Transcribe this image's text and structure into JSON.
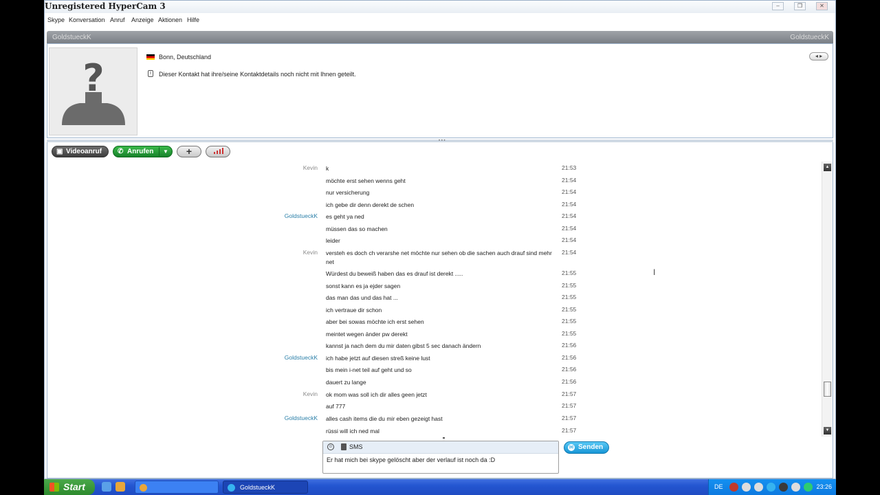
{
  "window": {
    "title": "Unregistered HyperCam 3",
    "controls": {
      "minimize": "–",
      "restore": "❐",
      "close": "✕"
    }
  },
  "menu": [
    "Skype",
    "Konversation",
    "Anruf",
    "Anzeige",
    "Aktionen",
    "Hilfe"
  ],
  "contact": {
    "name": "GoldstueckK",
    "mood": "GoldstueckK"
  },
  "profile": {
    "location": "Bonn, Deutschland",
    "details_notice": "Dieser Kontakt hat ihre/seine Kontaktdetails noch nicht mit Ihnen geteilt.",
    "avatar_glyph": "?",
    "expand_label": "◂ ▸"
  },
  "toolbar": {
    "video_call": "Videoanruf",
    "call": "Anrufen",
    "add": "+"
  },
  "messages": [
    {
      "sender": "Kevin",
      "text": "k",
      "time": "21:53"
    },
    {
      "sender": "",
      "text": "möchte erst sehen wenns geht",
      "time": "21:54"
    },
    {
      "sender": "",
      "text": "nur versicherung",
      "time": "21:54"
    },
    {
      "sender": "",
      "text": "ich gebe dir denn derekt de schen",
      "time": "21:54"
    },
    {
      "sender": "GoldstueckK",
      "text": "es geht ya ned",
      "time": "21:54"
    },
    {
      "sender": "",
      "text": "müssen das so machen",
      "time": "21:54"
    },
    {
      "sender": "",
      "text": "leider",
      "time": "21:54"
    },
    {
      "sender": "Kevin",
      "text": "versteh es doch ch verarshe net möchte nur sehen ob die sachen auch drauf sind mehr net",
      "time": "21:54"
    },
    {
      "sender": "",
      "text": "Würdest du beweiß haben das es drauf ist derekt .....",
      "time": "21:55"
    },
    {
      "sender": "",
      "text": "sonst kann es ja ejder sagen",
      "time": "21:55"
    },
    {
      "sender": "",
      "text": "das man das und das hat ...",
      "time": "21:55"
    },
    {
      "sender": "",
      "text": "ich vertraue dir schon",
      "time": "21:55"
    },
    {
      "sender": "",
      "text": "aber bei sowas möchte ich erst sehen",
      "time": "21:55"
    },
    {
      "sender": "",
      "text": "meintet wegen änder pw derekt",
      "time": "21:55"
    },
    {
      "sender": "",
      "text": "kannst ja  nach dem du mir daten gibst 5 sec danach ändern",
      "time": "21:56"
    },
    {
      "sender": "GoldstueckK",
      "text": "ich habe jetzt auf diesen streß keine lust",
      "time": "21:56"
    },
    {
      "sender": "",
      "text": "bis mein i-net teil auf geht und so",
      "time": "21:56"
    },
    {
      "sender": "",
      "text": "dauert zu lange",
      "time": "21:56"
    },
    {
      "sender": "Kevin",
      "text": "ok mom was soll ich dir alles geen jetzt",
      "time": "21:57"
    },
    {
      "sender": "",
      "text": "auf 777",
      "time": "21:57"
    },
    {
      "sender": "GoldstueckK",
      "text": "alles cash items die du mir eben gezeigt hast",
      "time": "21:57"
    },
    {
      "sender": "",
      "text": "rüssi will ich ned mal",
      "time": "21:57"
    }
  ],
  "composer": {
    "sms_label": "SMS",
    "input_value": "Er hat mich bei skype gelöscht aber der verlauf ist noch da :D",
    "send_label": "Senden"
  },
  "taskbar": {
    "start_label": "Start",
    "tasks": [
      "",
      "GoldstueckK"
    ],
    "language": "DE",
    "clock": "23:26"
  },
  "colors": {
    "sender_kevin": "#8a8a8a",
    "sender_gold": "#2a7fa8",
    "call_green": "#16822a",
    "send_blue": "#1896d6",
    "taskbar_blue": "#2456d1"
  }
}
